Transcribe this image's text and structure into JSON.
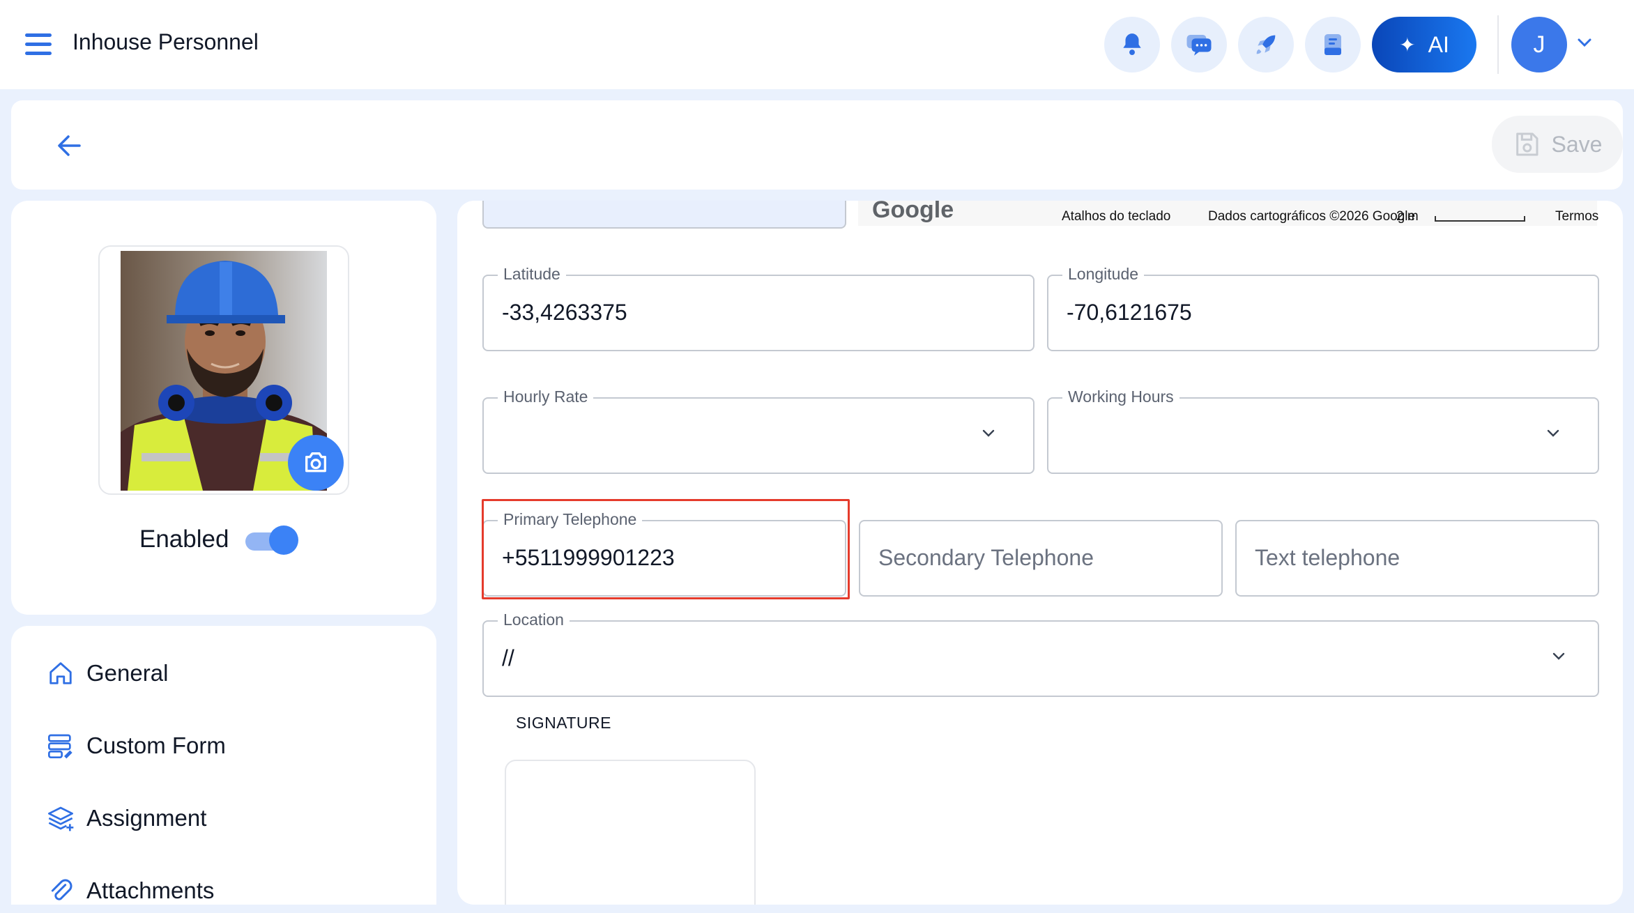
{
  "header": {
    "title": "Inhouse Personnel",
    "ai_label": "AI",
    "user_initial": "J"
  },
  "toolbar": {
    "save_label": "Save"
  },
  "profile": {
    "enabled_label": "Enabled",
    "enabled": true
  },
  "nav": {
    "items": [
      {
        "label": "General",
        "icon": "home-icon"
      },
      {
        "label": "Custom Form",
        "icon": "form-icon"
      },
      {
        "label": "Assignment",
        "icon": "layers-icon"
      },
      {
        "label": "Attachments",
        "icon": "paperclip-icon"
      }
    ]
  },
  "map": {
    "logo": "Google",
    "shortcuts": "Atalhos do teclado",
    "map_data": "Dados cartográficos ©2026 Google",
    "scale": "2 m",
    "terms": "Termos"
  },
  "form": {
    "latitude": {
      "label": "Latitude",
      "value": "-33,4263375"
    },
    "longitude": {
      "label": "Longitude",
      "value": "-70,6121675"
    },
    "hourly_rate": {
      "label": "Hourly Rate",
      "value": ""
    },
    "working_hours": {
      "label": "Working Hours",
      "value": ""
    },
    "primary_telephone": {
      "label": "Primary Telephone",
      "value": "+5511999901223"
    },
    "secondary_telephone": {
      "placeholder": "Secondary Telephone"
    },
    "text_telephone": {
      "placeholder": "Text telephone"
    },
    "location": {
      "label": "Location",
      "value": "//"
    },
    "signature_label": "SIGNATURE"
  },
  "colors": {
    "accent": "#3b82f6",
    "ai_gradient_start": "#0a46b8",
    "ai_gradient_end": "#1a78f0",
    "highlight": "#e53b2c",
    "background": "#eaf1fd"
  }
}
